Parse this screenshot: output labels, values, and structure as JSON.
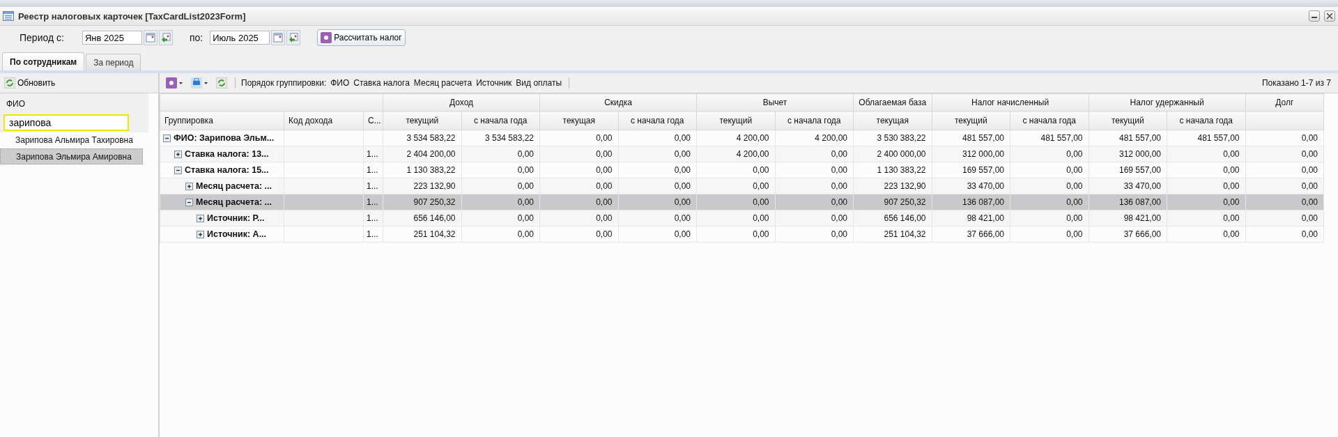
{
  "window": {
    "title": "Реестр налоговых карточек [TaxCardList2023Form]"
  },
  "period": {
    "from_label": "Период с:",
    "from_value": "Янв 2025",
    "to_label": "по:",
    "to_value": "Июль 2025",
    "calculate_button": "Рассчитать налог"
  },
  "tabs": [
    {
      "label": "По сотрудникам",
      "selected": true
    },
    {
      "label": "За период",
      "selected": false
    }
  ],
  "employees_panel": {
    "refresh_button": "Обновить",
    "column": "ФИО",
    "filter": "зарипова",
    "items": [
      {
        "name": "Зарипова Альмира Тахировна",
        "selected": false
      },
      {
        "name": "Зарипова Эльмира Амировна",
        "selected": true
      }
    ]
  },
  "grid_toolbar": {
    "grouping_label": "Порядок группировки:",
    "grouping": [
      "ФИО",
      "Ставка налога",
      "Месяц расчета",
      "Источник",
      "Вид оплаты"
    ],
    "paging": "Показано 1-7 из 7"
  },
  "table": {
    "leading_columns": [
      "Группировка",
      "Код дохода",
      "С..."
    ],
    "column_groups": [
      {
        "label": "Доход",
        "columns": [
          "текущий",
          "с начала года"
        ]
      },
      {
        "label": "Скидка",
        "columns": [
          "текущая",
          "с начала года"
        ]
      },
      {
        "label": "Вычет",
        "columns": [
          "текущий",
          "с начала года"
        ]
      },
      {
        "label": "Облагаемая база",
        "columns": [
          "текущая"
        ]
      },
      {
        "label": "Налог начисленный",
        "columns": [
          "текущий",
          "с начала года"
        ]
      },
      {
        "label": "Налог удержанный",
        "columns": [
          "текущий",
          "с начала года"
        ]
      },
      {
        "label": "Долг"
      }
    ],
    "rows": [
      {
        "group": "ФИО: Зарипова Эльм...",
        "expanded": true,
        "selected": false,
        "values": [
          "3 534 583,22",
          "3 534 583,22",
          "0,00",
          "0,00",
          "4 200,00",
          "4 200,00",
          "3 530 383,22",
          "481 557,00",
          "481 557,00",
          "481 557,00",
          "481 557,00",
          "0,00"
        ],
        "children": [
          {
            "group": "Ставка налога: 13...",
            "column_3": "1...",
            "expanded": false,
            "selected": false,
            "values": [
              "2 404 200,00",
              "0,00",
              "0,00",
              "0,00",
              "4 200,00",
              "0,00",
              "2 400 000,00",
              "312 000,00",
              "0,00",
              "312 000,00",
              "0,00",
              "0,00"
            ]
          },
          {
            "group": "Ставка налога: 15...",
            "column_3": "1...",
            "expanded": true,
            "selected": false,
            "values": [
              "1 130 383,22",
              "0,00",
              "0,00",
              "0,00",
              "0,00",
              "0,00",
              "1 130 383,22",
              "169 557,00",
              "0,00",
              "169 557,00",
              "0,00",
              "0,00"
            ],
            "children": [
              {
                "group": "Месяц расчета: ...",
                "column_3": "1...",
                "expanded": false,
                "selected": false,
                "values": [
                  "223 132,90",
                  "0,00",
                  "0,00",
                  "0,00",
                  "0,00",
                  "0,00",
                  "223 132,90",
                  "33 470,00",
                  "0,00",
                  "33 470,00",
                  "0,00",
                  "0,00"
                ]
              },
              {
                "group": "Месяц расчета: ...",
                "column_3": "1...",
                "expanded": true,
                "selected": true,
                "values": [
                  "907 250,32",
                  "0,00",
                  "0,00",
                  "0,00",
                  "0,00",
                  "0,00",
                  "907 250,32",
                  "136 087,00",
                  "0,00",
                  "136 087,00",
                  "0,00",
                  "0,00"
                ],
                "children": [
                  {
                    "group": "Источник: Р...",
                    "column_3": "1...",
                    "expanded": false,
                    "selected": false,
                    "values": [
                      "656 146,00",
                      "0,00",
                      "0,00",
                      "0,00",
                      "0,00",
                      "0,00",
                      "656 146,00",
                      "98 421,00",
                      "0,00",
                      "98 421,00",
                      "0,00",
                      "0,00"
                    ]
                  },
                  {
                    "group": "Источник: А...",
                    "column_3": "1...",
                    "expanded": false,
                    "selected": false,
                    "values": [
                      "251 104,32",
                      "0,00",
                      "0,00",
                      "0,00",
                      "0,00",
                      "0,00",
                      "251 104,32",
                      "37 666,00",
                      "0,00",
                      "37 666,00",
                      "0,00",
                      "0,00"
                    ]
                  }
                ]
              }
            ]
          }
        ]
      }
    ]
  }
}
